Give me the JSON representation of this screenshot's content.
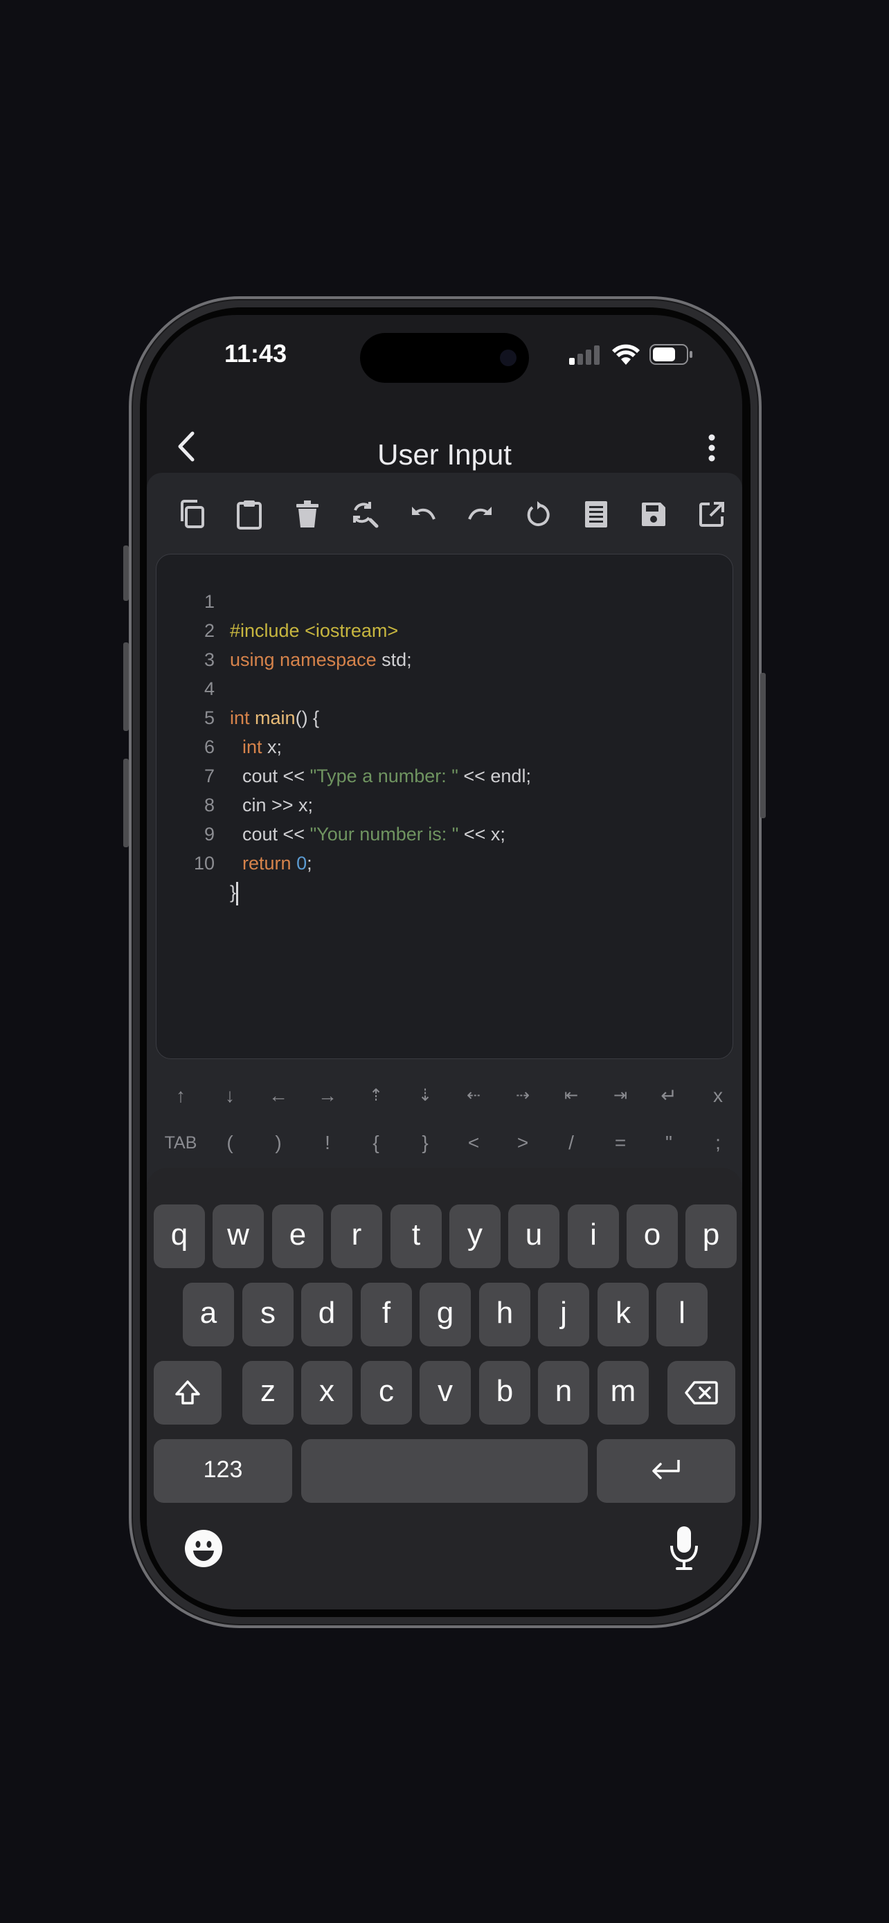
{
  "status": {
    "time": "11:43"
  },
  "header": {
    "title": "User Input"
  },
  "toolbar": {
    "tools": [
      "copy-icon",
      "paste-icon",
      "delete-icon",
      "find-replace-icon",
      "undo-icon",
      "redo-icon",
      "refresh-icon",
      "format-icon",
      "save-icon",
      "open-external-icon"
    ]
  },
  "editor": {
    "line_numbers": [
      "1",
      "2",
      "3",
      "4",
      "5",
      "6",
      "7",
      "8",
      "9",
      "10"
    ],
    "lines": {
      "l1": "#include <iostream>",
      "l2_kw": "using namespace",
      "l2_rest": " std;",
      "l4_kw": "int",
      "l4_fn": "main",
      "l4_rest": "() {",
      "l5_kw": "int",
      "l5_rest": " x;",
      "l6_a": "cout << ",
      "l6_str": "\"Type a number: \"",
      "l6_b": " << endl;",
      "l7": "cin >> x;",
      "l8_a": "cout << ",
      "l8_str": "\"Your number is: \"",
      "l8_b": " << x;",
      "l9_kw": "return",
      "l9_num": "0",
      "l9_rest": ";",
      "l10": "}"
    }
  },
  "extra_keys": {
    "row1": [
      "↑",
      "↓",
      "←",
      "→",
      "⇡",
      "⇣",
      "⇠",
      "⇢",
      "⇤",
      "⇥",
      "↵",
      "x"
    ],
    "row2": [
      "TAB",
      "(",
      ")",
      "!",
      "{",
      "}",
      "<",
      ">",
      "/",
      "=",
      "\"",
      ";"
    ]
  },
  "keyboard": {
    "row1": [
      "q",
      "w",
      "e",
      "r",
      "t",
      "y",
      "u",
      "i",
      "o",
      "p"
    ],
    "row2": [
      "a",
      "s",
      "d",
      "f",
      "g",
      "h",
      "j",
      "k",
      "l"
    ],
    "row3": [
      "z",
      "x",
      "c",
      "v",
      "b",
      "n",
      "m"
    ],
    "numbers_label": "123"
  },
  "colors": {
    "accent": "#5b3a96",
    "keyword": "#d6834b",
    "string": "#6f9460",
    "number": "#5b9bd2",
    "preprocessor": "#c7b63f"
  }
}
